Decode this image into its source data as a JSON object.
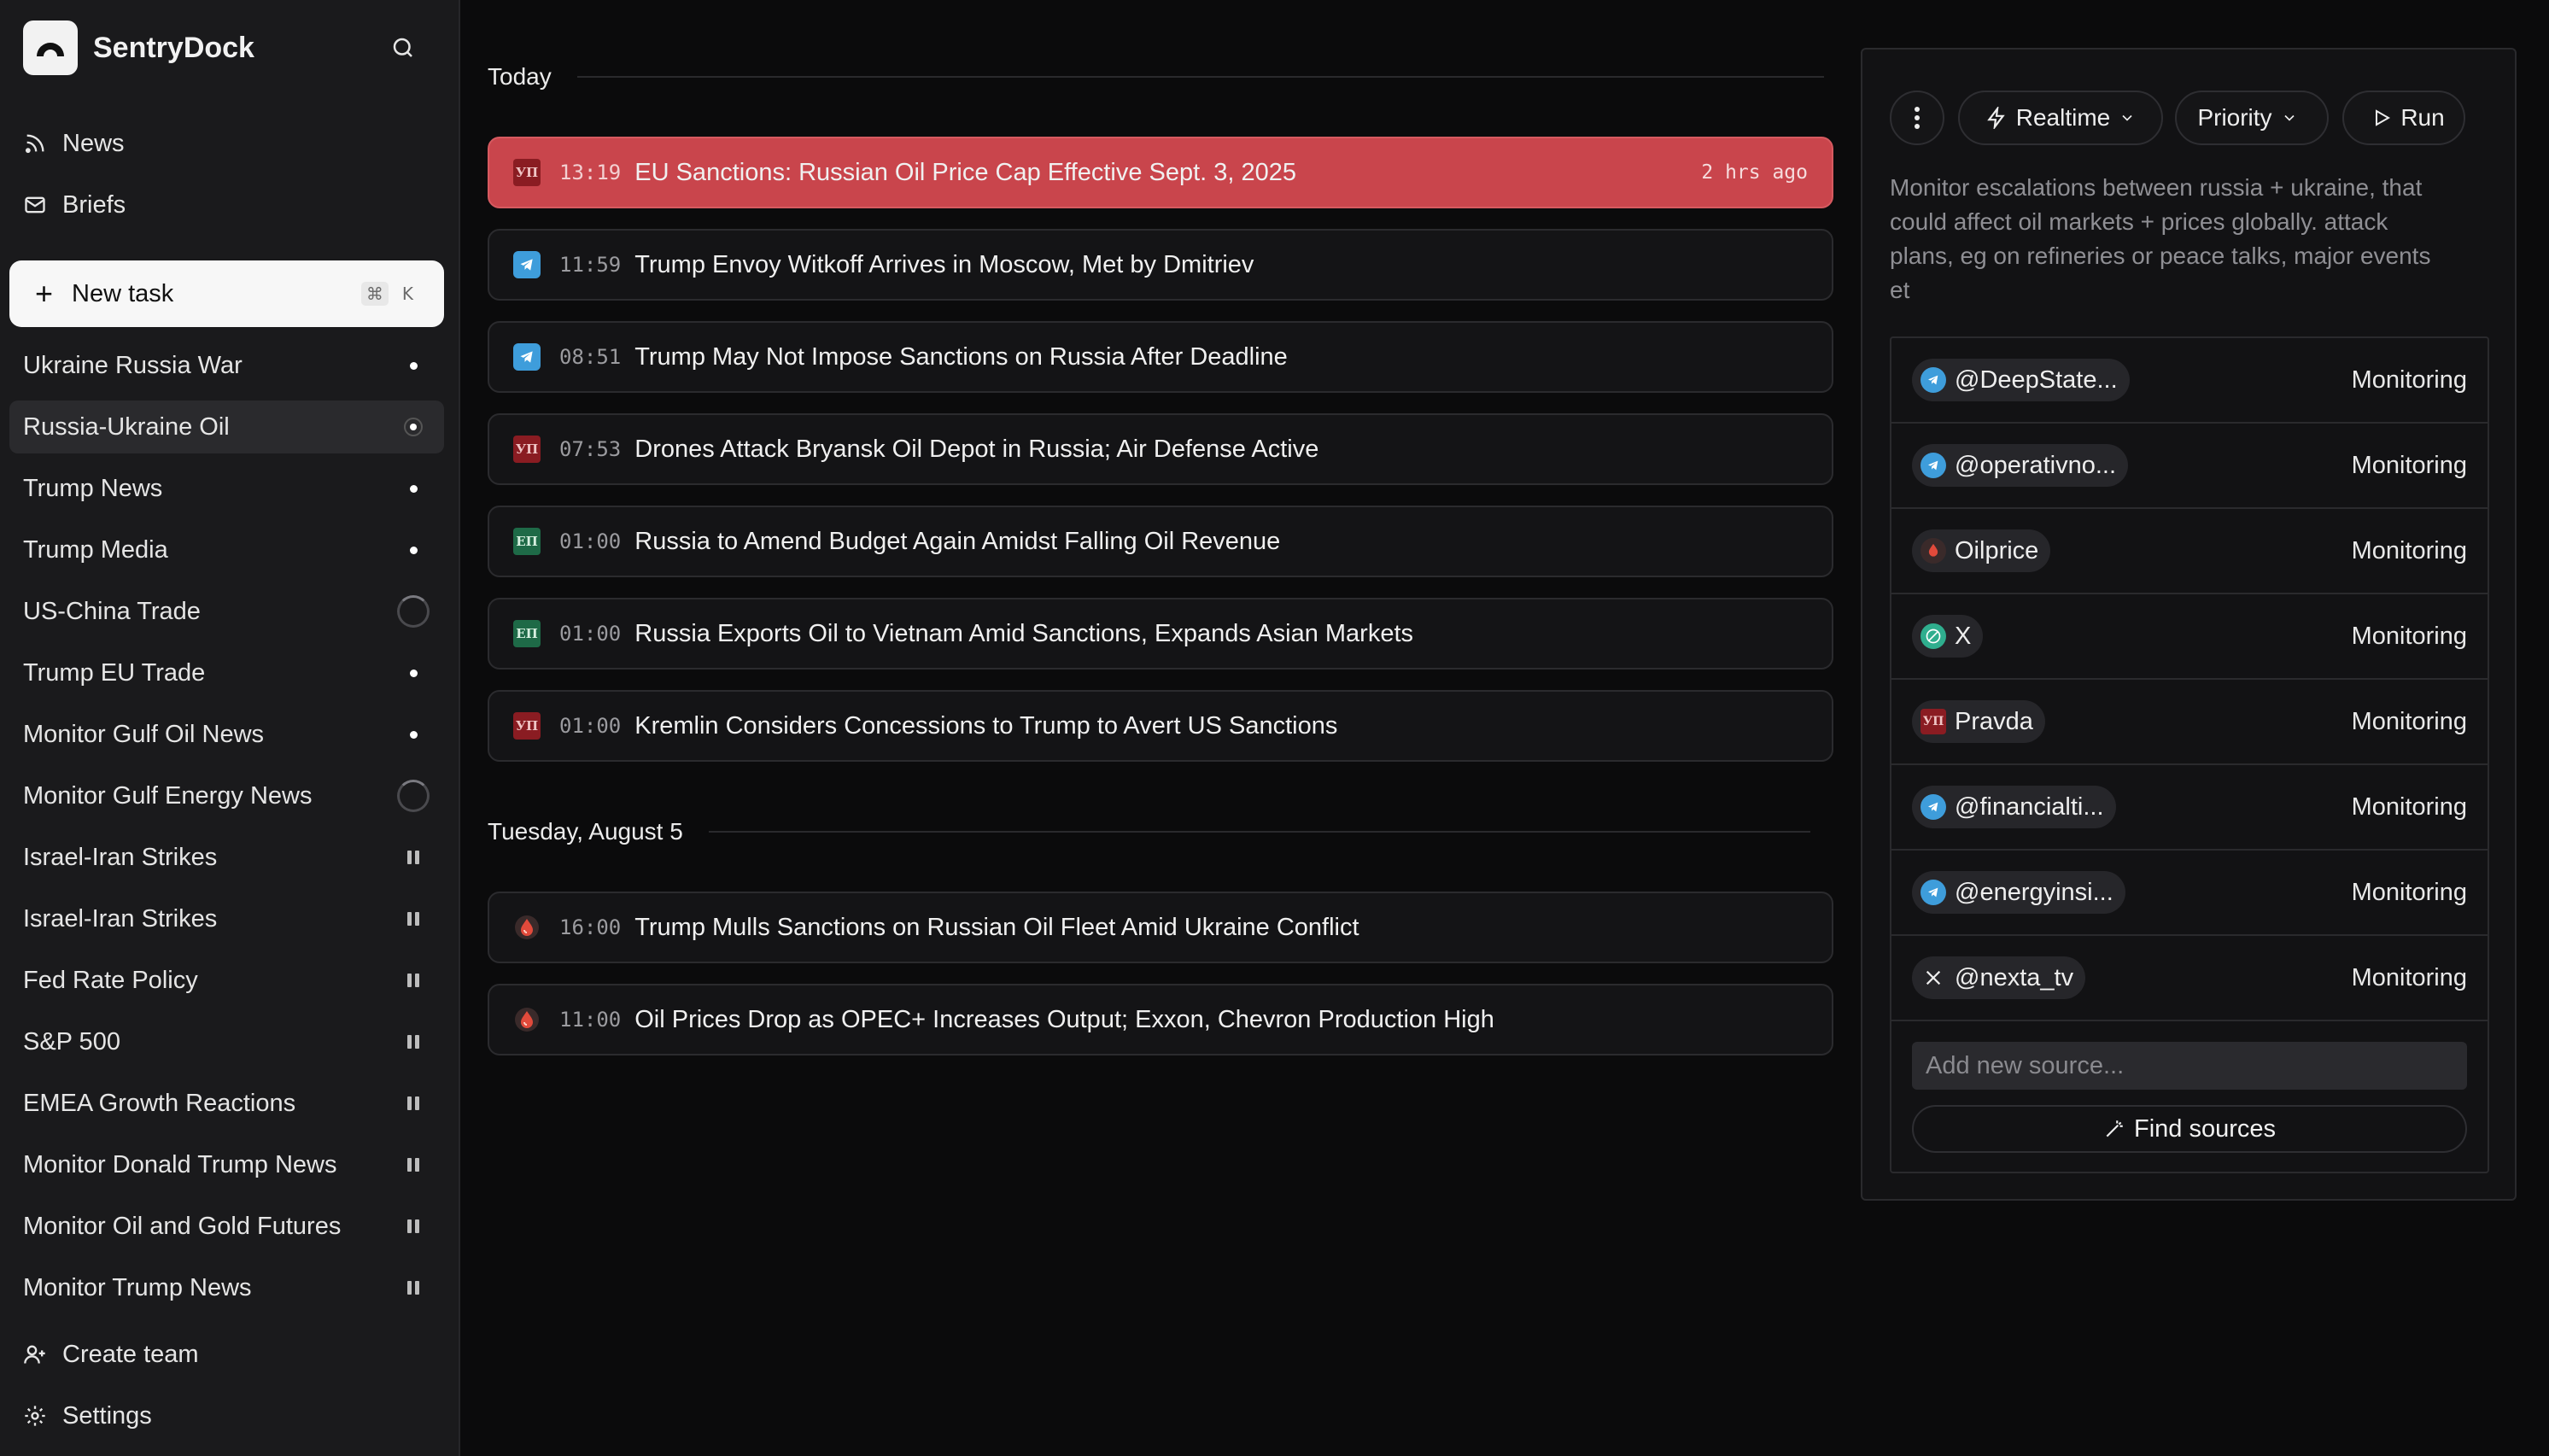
{
  "app": {
    "name": "SentryDock"
  },
  "nav": {
    "news": "News",
    "briefs": "Briefs"
  },
  "new_task": {
    "label": "New task",
    "shortcut_mod": "⌘",
    "shortcut_key": "K"
  },
  "tasks": [
    {
      "label": "Ukraine Russia War",
      "status": "dot"
    },
    {
      "label": "Russia-Ukraine Oil",
      "status": "dot-ring",
      "active": true
    },
    {
      "label": "Trump News",
      "status": "dot"
    },
    {
      "label": "Trump Media",
      "status": "dot"
    },
    {
      "label": "US-China Trade",
      "status": "spinner"
    },
    {
      "label": "Trump EU Trade",
      "status": "dot"
    },
    {
      "label": "Monitor Gulf Oil News",
      "status": "dot"
    },
    {
      "label": "Monitor Gulf Energy News",
      "status": "spinner"
    },
    {
      "label": "Israel-Iran Strikes",
      "status": "paused"
    },
    {
      "label": "Israel-Iran Strikes",
      "status": "paused"
    },
    {
      "label": "Fed Rate Policy",
      "status": "paused"
    },
    {
      "label": "S&P 500",
      "status": "paused"
    },
    {
      "label": "EMEA Growth Reactions",
      "status": "paused"
    },
    {
      "label": "Monitor Donald Trump News",
      "status": "paused"
    },
    {
      "label": "Monitor Oil and Gold Futures",
      "status": "paused"
    },
    {
      "label": "Monitor Trump News",
      "status": "paused"
    }
  ],
  "bottom": {
    "create_team": "Create team",
    "settings": "Settings"
  },
  "feed": {
    "today_label": "Today",
    "today": [
      {
        "source": "yp",
        "source_glyph": "УП",
        "time": "13:19",
        "title": "EU Sanctions: Russian Oil Price Cap Effective Sept. 3, 2025",
        "ago": "2 hrs ago",
        "highlight": true
      },
      {
        "source": "tg",
        "time": "11:59",
        "title": "Trump Envoy Witkoff Arrives in Moscow, Met by Dmitriev"
      },
      {
        "source": "tg",
        "time": "08:51",
        "title": "Trump May Not Impose Sanctions on Russia After Deadline"
      },
      {
        "source": "yp",
        "source_glyph": "УП",
        "time": "07:53",
        "title": "Drones Attack Bryansk Oil Depot in Russia; Air Defense Active"
      },
      {
        "source": "eu",
        "source_glyph": "ЕП",
        "time": "01:00",
        "title": "Russia to Amend Budget Again Amidst Falling Oil Revenue"
      },
      {
        "source": "eu",
        "source_glyph": "ЕП",
        "time": "01:00",
        "title": "Russia Exports Oil to Vietnam Amid Sanctions, Expands Asian Markets"
      },
      {
        "source": "yp",
        "source_glyph": "УП",
        "time": "01:00",
        "title": "Kremlin Considers Concessions to Trump to Avert US Sanctions"
      }
    ],
    "earlier_label": "Tuesday, August 5",
    "earlier": [
      {
        "source": "oil",
        "time": "16:00",
        "title": "Trump Mulls Sanctions on Russian Oil Fleet Amid Ukraine Conflict"
      },
      {
        "source": "oil",
        "time": "11:00",
        "title": "Oil Prices Drop as OPEC+ Increases Output; Exxon, Chevron Production High"
      }
    ]
  },
  "panel": {
    "mode": "Realtime",
    "priority": "Priority",
    "run": "Run",
    "description": "Monitor escalations between russia + ukraine, that could affect oil markets + prices globally. attack plans, eg on refineries or peace talks, major events et",
    "sources": [
      {
        "name": "@DeepState...",
        "type": "telegram",
        "status": "Monitoring"
      },
      {
        "name": "@operativno...",
        "type": "telegram",
        "status": "Monitoring"
      },
      {
        "name": "Oilprice",
        "type": "oilprice",
        "status": "Monitoring"
      },
      {
        "name": "X",
        "type": "web",
        "status": "Monitoring"
      },
      {
        "name": "Pravda",
        "type": "pravda",
        "glyph": "УП",
        "status": "Monitoring"
      },
      {
        "name": "@financialti...",
        "type": "telegram",
        "status": "Monitoring"
      },
      {
        "name": "@energyinsi...",
        "type": "telegram",
        "status": "Monitoring"
      },
      {
        "name": "@nexta_tv",
        "type": "x",
        "status": "Monitoring"
      }
    ],
    "add_source_placeholder": "Add new source...",
    "find_sources": "Find sources"
  },
  "colors": {
    "highlight": "#c9454c",
    "background": "#0b0b0c",
    "sidebar": "#1a1a1c",
    "telegram": "#3e9ddb"
  }
}
